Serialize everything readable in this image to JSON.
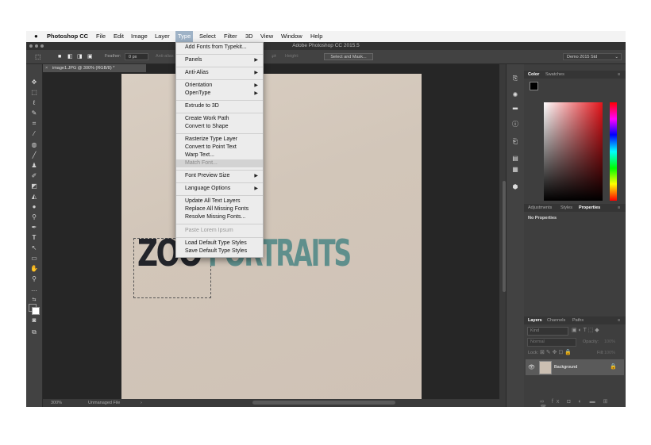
{
  "menubar": {
    "apple": "",
    "app_name": "Photoshop CC",
    "items": [
      "File",
      "Edit",
      "Image",
      "Layer",
      "Type",
      "Select",
      "Filter",
      "3D",
      "View",
      "Window",
      "Help"
    ]
  },
  "window": {
    "title": "Adobe Photoshop CC 2015.5"
  },
  "options_bar": {
    "feather_label": "Feather:",
    "feather_value": "0 px",
    "anti_alias": "Anti-alias",
    "height_label": "Height:",
    "select_mask_button": "Select and Mask...",
    "workspace": "Demo 2015 Std"
  },
  "document": {
    "tab_title": "image1.JPG @ 300% (RGB/8) *",
    "canvas_text_dark": "ZOO",
    "canvas_text_teal": "PORTRAITS",
    "zoom": "300%",
    "profile": "Unmanaged File"
  },
  "type_menu": {
    "items": [
      {
        "label": "Add Fonts from Typekit...",
        "arrow": ""
      },
      {
        "label": "Panels",
        "arrow": "▶"
      },
      {
        "label": "Anti-Alias",
        "arrow": "▶"
      },
      {
        "label": "Orientation",
        "arrow": "▶"
      },
      {
        "label": "OpenType",
        "arrow": "▶"
      },
      {
        "label": "Extrude to 3D",
        "arrow": ""
      },
      {
        "label": "Create Work Path",
        "arrow": ""
      },
      {
        "label": "Convert to Shape",
        "arrow": ""
      },
      {
        "label": "Rasterize Type Layer",
        "arrow": ""
      },
      {
        "label": "Convert to Point Text",
        "arrow": ""
      },
      {
        "label": "Warp Text...",
        "arrow": ""
      },
      {
        "label": "Match Font...",
        "arrow": ""
      },
      {
        "label": "Font Preview Size",
        "arrow": "▶"
      },
      {
        "label": "Language Options",
        "arrow": "▶"
      },
      {
        "label": "Update All Text Layers",
        "arrow": ""
      },
      {
        "label": "Replace All Missing Fonts",
        "arrow": ""
      },
      {
        "label": "Resolve Missing Fonts...",
        "arrow": ""
      },
      {
        "label": "Paste Lorem Ipsum",
        "arrow": ""
      },
      {
        "label": "Load Default Type Styles",
        "arrow": ""
      },
      {
        "label": "Save Default Type Styles",
        "arrow": ""
      }
    ]
  },
  "panels": {
    "color_tabs": [
      "Color",
      "Swatches"
    ],
    "props_tabs": [
      "Adjustments",
      "Styles",
      "Properties"
    ],
    "no_properties": "No Properties",
    "layers_tabs": [
      "Layers",
      "Channels",
      "Paths"
    ],
    "kind_label": "Kind",
    "blend_mode": "Normal",
    "opacity_label": "Opacity:",
    "opacity_value": "100%",
    "lock_label": "Lock:",
    "fill_label": "Fill:",
    "fill_value": "100%",
    "layer_name": "Background",
    "foreground_color": "#000000",
    "background_color": "#ffffff"
  },
  "colors": {
    "accent_menu_highlight": "#9fb3c7",
    "canvas_teal": "#5f8f8c",
    "canvas_dark": "#22242a"
  }
}
